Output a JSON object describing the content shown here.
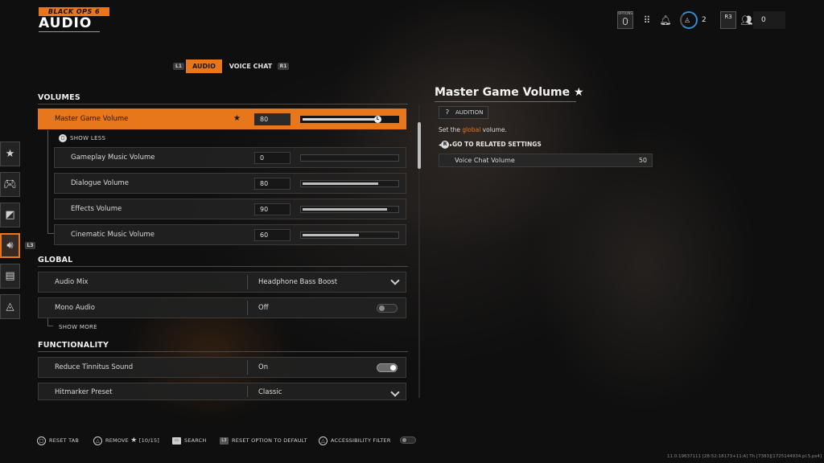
{
  "header": {
    "game_logo": "BLACK OPS 6",
    "title": "AUDIO",
    "hud": {
      "options_label": "OPTIONS",
      "level_count": "2",
      "r3_label": "R3",
      "party_count": "0"
    }
  },
  "tabs": {
    "left_hint": "L1",
    "right_hint": "R1",
    "items": [
      {
        "label": "AUDIO",
        "active": true
      },
      {
        "label": "VOICE CHAT",
        "active": false
      }
    ]
  },
  "sections": {
    "volumes": {
      "title": "VOLUMES",
      "master": {
        "label": "Master Game Volume",
        "value": "80",
        "level": 0.8,
        "knob_glyph": "L"
      },
      "show_less": "SHOW LESS",
      "show_less_glyph": "◻",
      "sub": [
        {
          "label": "Gameplay Music Volume",
          "value": "0",
          "level": 0.0
        },
        {
          "label": "Dialogue Volume",
          "value": "80",
          "level": 0.8
        },
        {
          "label": "Effects Volume",
          "value": "90",
          "level": 0.9
        },
        {
          "label": "Cinematic Music Volume",
          "value": "60",
          "level": 0.6
        }
      ]
    },
    "global": {
      "title": "GLOBAL",
      "audio_mix": {
        "label": "Audio Mix",
        "value": "Headphone Bass Boost"
      },
      "mono_audio": {
        "label": "Mono Audio",
        "value": "Off",
        "on": false
      },
      "show_more": "SHOW MORE"
    },
    "functionality": {
      "title": "FUNCTIONALITY",
      "tinnitus": {
        "label": "Reduce Tinnitus Sound",
        "value": "On",
        "on": true
      },
      "hitmarker": {
        "label": "Hitmarker Preset",
        "value": "Classic"
      }
    }
  },
  "side_rail": {
    "items": [
      "star-icon",
      "gamepad-icon",
      "display-icon",
      "speaker-icon",
      "interface-icon",
      "network-icon"
    ],
    "active_index": 3,
    "active_hint": "L3"
  },
  "detail": {
    "title": "Master Game Volume",
    "audition_label": "AUDITION",
    "desc_before": "Set the ",
    "desc_highlight": "global",
    "desc_after": " volume.",
    "related_glyph": "R",
    "related_heading": "GO TO RELATED SETTINGS",
    "related": {
      "label": "Voice Chat Volume",
      "value": "50"
    }
  },
  "footer": {
    "reset_tab": "RESET TAB",
    "remove": "REMOVE",
    "remove_count": "[10/15]",
    "search": "SEARCH",
    "reset_hint": "L3",
    "reset_default": "RESET OPTION TO DEFAULT",
    "accessibility": "ACCESSIBILITY FILTER",
    "build": "11.0.19637111 [28:52:18173+11:A] Th [7383][1725144934.pl.5.ps4]"
  },
  "colors": {
    "accent": "#e8761a",
    "panel": "#222222",
    "text": "#d6d6d6"
  }
}
